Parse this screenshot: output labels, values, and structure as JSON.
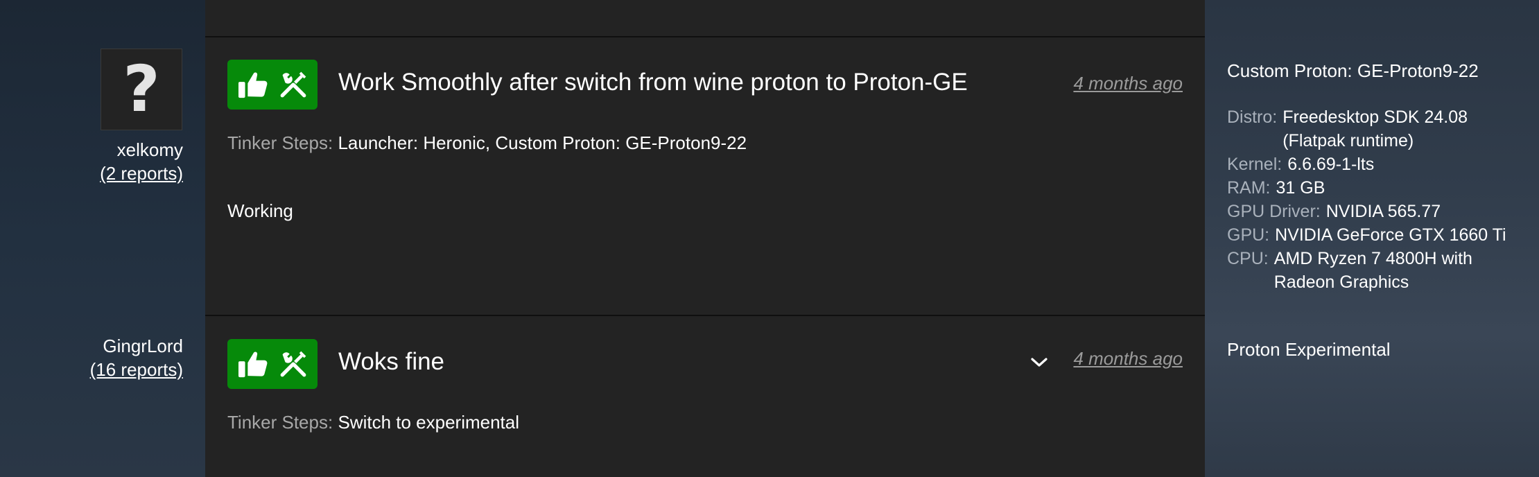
{
  "reports": [
    {
      "user": {
        "name": "xelkomy",
        "reports_link": "(2 reports)"
      },
      "avatar_glyph": "?",
      "title": "Work Smoothly after switch from wine proton to Proton-GE",
      "time_ago": "4 months ago",
      "tinker_label": "Tinker Steps:",
      "tinker_value": "Launcher: Heronic, Custom Proton: GE-Proton9-22",
      "notes": "Working",
      "sidebar": {
        "proton": "Custom Proton: GE-Proton9-22",
        "specs": [
          {
            "key": "Distro:",
            "lines": [
              "Freedesktop SDK 24.08",
              "(Flatpak runtime)"
            ]
          },
          {
            "key": "Kernel:",
            "lines": [
              "6.6.69-1-lts"
            ]
          },
          {
            "key": "RAM:",
            "lines": [
              "31 GB"
            ]
          },
          {
            "key": "GPU Driver:",
            "lines": [
              "NVIDIA 565.77"
            ]
          },
          {
            "key": "GPU:",
            "lines": [
              "NVIDIA GeForce GTX 1660 Ti"
            ]
          },
          {
            "key": "CPU:",
            "lines": [
              "AMD Ryzen 7 4800H with",
              "Radeon Graphics"
            ]
          }
        ]
      }
    },
    {
      "user": {
        "name": "GingrLord",
        "reports_link": "(16 reports)"
      },
      "title": "Woks fine",
      "time_ago": "4 months ago",
      "tinker_label": "Tinker Steps:",
      "tinker_value": "Switch to experimental",
      "sidebar": {
        "proton": "Proton Experimental"
      }
    }
  ],
  "icons": [
    "thumbs-up-icon",
    "tools-icon",
    "chevron-down-icon"
  ],
  "colors": {
    "badge_green": "#068a0a",
    "panel_bg": "#232323",
    "muted_text": "#a8a8a8",
    "link_muted": "#9b9b9b"
  }
}
